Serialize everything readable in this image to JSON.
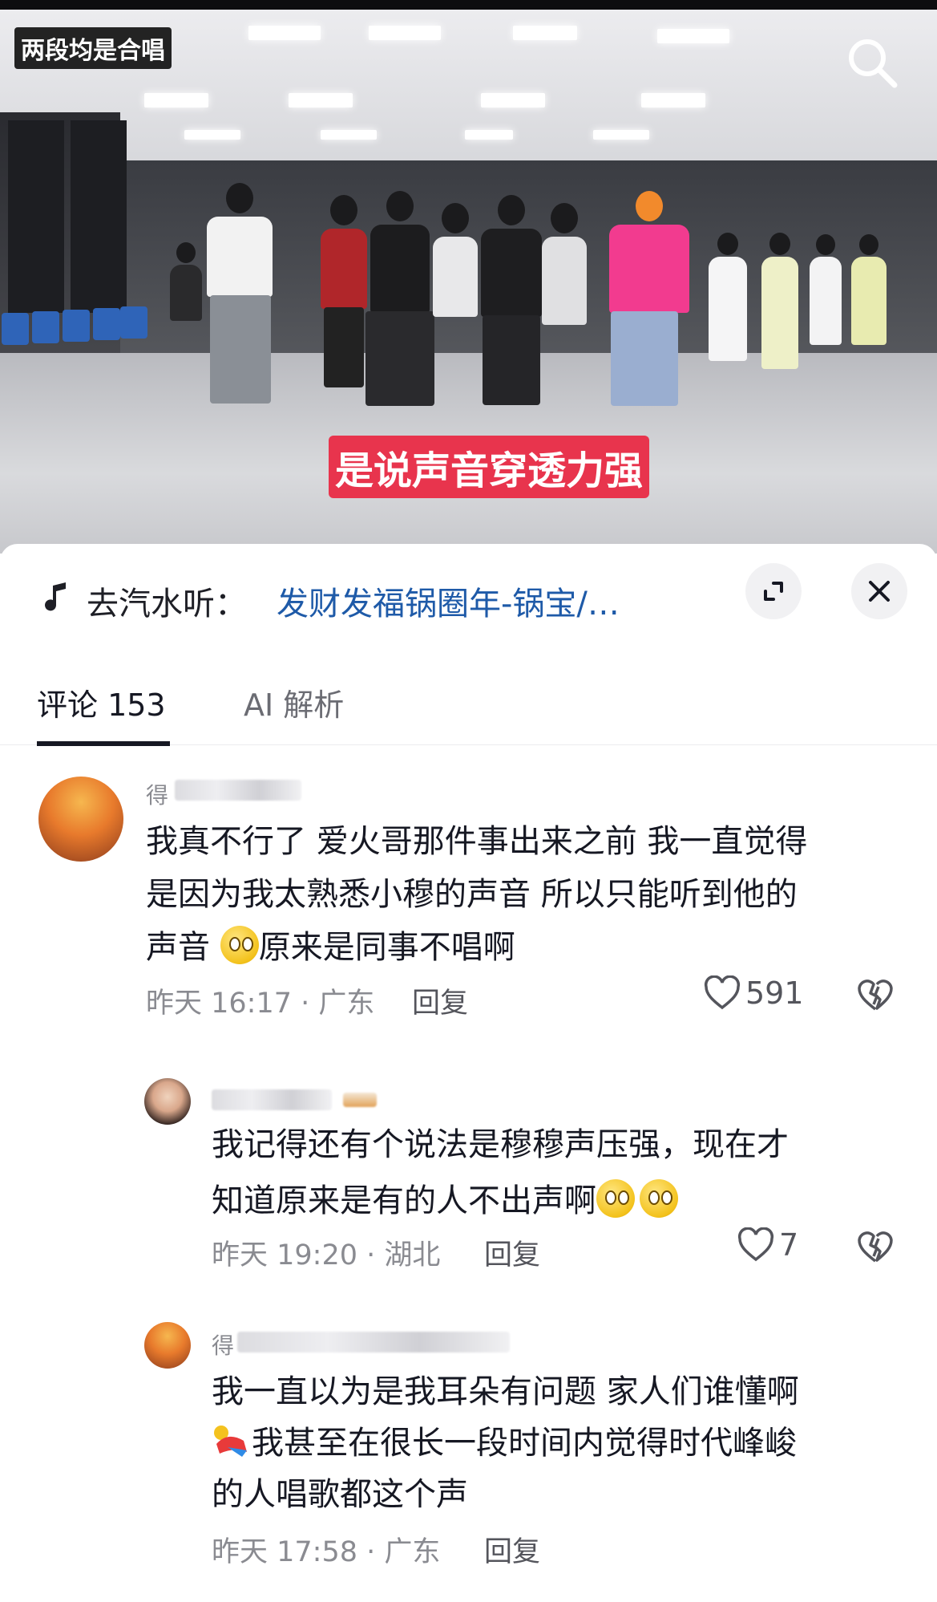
{
  "video": {
    "title_tag": "两段均是合唱",
    "caption": "是说声音穿透力强"
  },
  "music": {
    "prefix": "去汽水听：",
    "song": "发财发福锅圈年-锅宝/…"
  },
  "tabs": [
    {
      "label": "评论 153",
      "active": true
    },
    {
      "label": "AI 解析",
      "active": false
    }
  ],
  "comments": [
    {
      "name_visible": "得",
      "text_line1": "我真不行了 爱火哥那件事出来之前 我一直觉得",
      "text_line2": "是因为我太熟悉小穆的声音 所以只能听到他的",
      "text_line3a": "声音",
      "text_line3b": "原来是同事不唱啊",
      "time": "昨天 16:17 · 广东",
      "reply_label": "回复",
      "likes": "591"
    },
    {
      "name_visible": "",
      "text_line1": "我记得还有个说法是穆穆声压强，现在才",
      "text_line2": "知道原来是有的人不出声啊",
      "time": "昨天 19:20 · 湖北",
      "reply_label": "回复",
      "likes": "7"
    },
    {
      "name_visible": "得",
      "text_line1": "我一直以为是我耳朵有问题 家人们谁懂啊",
      "text_line2": "我甚至在很长一段时间内觉得时代峰峻",
      "text_line3": "的人唱歌都这个声",
      "time": "昨天 17:58 · 广东",
      "reply_label": "回复"
    }
  ],
  "colors": {
    "caption_bg": "#e8344d",
    "link": "#1e5aa8",
    "meta": "#8a8b91"
  },
  "icons": [
    "search-icon",
    "music-note-icon",
    "expand-icon",
    "close-icon",
    "heart-icon",
    "broken-heart-icon"
  ]
}
